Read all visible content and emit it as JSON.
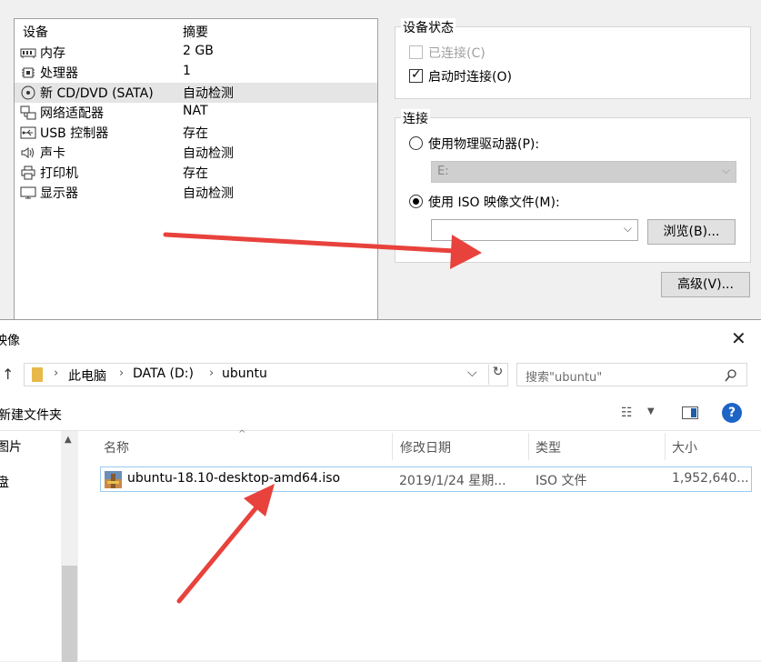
{
  "vm_settings": {
    "device_list": {
      "header_device": "设备",
      "header_summary": "摘要",
      "rows": [
        {
          "name": "内存",
          "summary": "2 GB",
          "icon": "memory-icon"
        },
        {
          "name": "处理器",
          "summary": "1",
          "icon": "cpu-icon"
        },
        {
          "name": "新 CD/DVD (SATA)",
          "summary": "自动检测",
          "icon": "cd-dvd-icon"
        },
        {
          "name": "网络适配器",
          "summary": "NAT",
          "icon": "network-adapter-icon"
        },
        {
          "name": "USB 控制器",
          "summary": "存在",
          "icon": "usb-icon"
        },
        {
          "name": "声卡",
          "summary": "自动检测",
          "icon": "speaker-icon"
        },
        {
          "name": "打印机",
          "summary": "存在",
          "icon": "printer-icon"
        },
        {
          "name": "显示器",
          "summary": "自动检测",
          "icon": "monitor-icon"
        }
      ]
    },
    "device_status": {
      "title": "设备状态",
      "connected_label": "已连接(C)",
      "connect_on_power_label": "启动时连接(O)"
    },
    "connection": {
      "title": "连接",
      "physical_drive_label": "使用物理驱动器(P):",
      "physical_drive_value": "E:",
      "iso_label": "使用 ISO 映像文件(M):",
      "iso_value": "",
      "browse_label": "浏览(B)..."
    },
    "advanced_label": "高级(V)..."
  },
  "file_dialog": {
    "title": "映像",
    "breadcrumbs": [
      "此电脑",
      "DATA (D:)",
      "ubuntu"
    ],
    "search_placeholder": "搜索\"ubuntu\"",
    "new_folder_label": "新建文件夹",
    "nav_items": [
      "图片",
      "盘"
    ],
    "columns": {
      "name": "名称",
      "modified": "修改日期",
      "type": "类型",
      "size": "大小"
    },
    "files": [
      {
        "name": "ubuntu-18.10-desktop-amd64.iso",
        "modified": "2019/1/24 星期...",
        "type": "ISO 文件",
        "size": "1,952,640..."
      }
    ]
  },
  "annotation_color": "#e8423c"
}
